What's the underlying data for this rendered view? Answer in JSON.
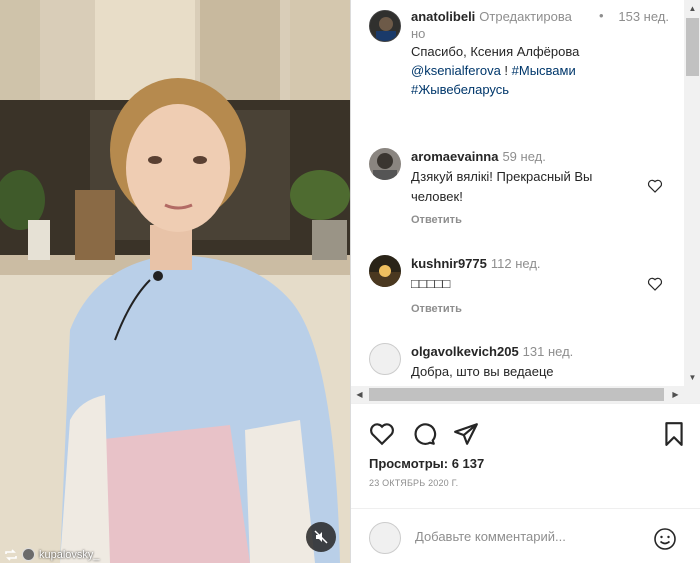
{
  "video": {
    "credit_username": "kupalovsky_",
    "mute_icon": "muted-speaker-icon"
  },
  "caption": {
    "username": "anatolibeli",
    "edited_label": "Отредактирова но",
    "time_label": "153 нед.",
    "text": "Спасибо, Ксения Алфёрова",
    "mention": "@ksenialferova",
    "sep": " ! ",
    "hashtag1": "#Мысвами",
    "hashtag2": "#Жывебеларусь"
  },
  "comments": [
    {
      "username": "aromaevainna",
      "time": "59 нед.",
      "text": "Дзякуй вялікі! Прекрасный Вы человек!",
      "reply_label": "Ответить"
    },
    {
      "username": "kushnir9775",
      "time": "112 нед.",
      "text": "□□□□□",
      "reply_label": "Ответить"
    },
    {
      "username": "olgavolkevich205",
      "time": "131 нед.",
      "text": "Добра, што вы ведаеце",
      "reply_label": ""
    }
  ],
  "actions": {
    "views_label": "Просмотры: 6 137",
    "date": "23 ОКТЯБРЬ 2020 Г."
  },
  "add_comment": {
    "placeholder": "Добавьте комментарий..."
  },
  "colors": {
    "link": "#00376b",
    "muted_text": "#8e8e8e",
    "text": "#262626"
  }
}
